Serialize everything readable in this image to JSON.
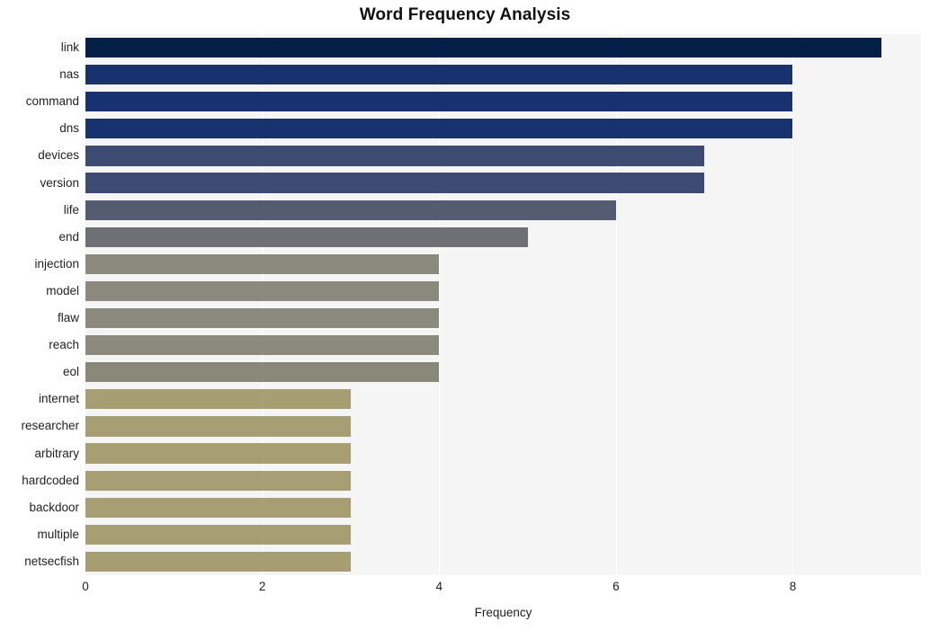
{
  "chart_data": {
    "type": "bar",
    "orientation": "horizontal",
    "title": "Word Frequency Analysis",
    "xlabel": "Frequency",
    "ylabel": "",
    "categories": [
      "link",
      "nas",
      "command",
      "dns",
      "devices",
      "version",
      "life",
      "end",
      "injection",
      "model",
      "flaw",
      "reach",
      "eol",
      "internet",
      "researcher",
      "arbitrary",
      "hardcoded",
      "backdoor",
      "multiple",
      "netsecfish"
    ],
    "values": [
      9,
      8,
      8,
      8,
      7,
      7,
      6,
      5,
      4,
      4,
      4,
      4,
      4,
      3,
      3,
      3,
      3,
      3,
      3,
      3
    ],
    "bar_colors": [
      "#042049",
      "#17326e",
      "#17326e",
      "#17326e",
      "#3d4a71",
      "#3d4a71",
      "#555b70",
      "#6e7076",
      "#8b8a7c",
      "#8b8a7c",
      "#8b8a7c",
      "#8b8a7c",
      "#8a8878",
      "#a89e74",
      "#a89e74",
      "#a89e74",
      "#a89e74",
      "#a89e74",
      "#a89e74",
      "#a79d73"
    ],
    "xlim": [
      0,
      9.45
    ],
    "xticks": [
      0,
      2,
      4,
      6,
      8
    ],
    "xtick_labels": [
      "0",
      "2",
      "4",
      "6",
      "8"
    ],
    "grid": true,
    "grid_axis": "x",
    "grid_color": "#ffffff",
    "plot_background": "#f5f5f6",
    "figure_background": "#ffffff",
    "legend": null
  }
}
